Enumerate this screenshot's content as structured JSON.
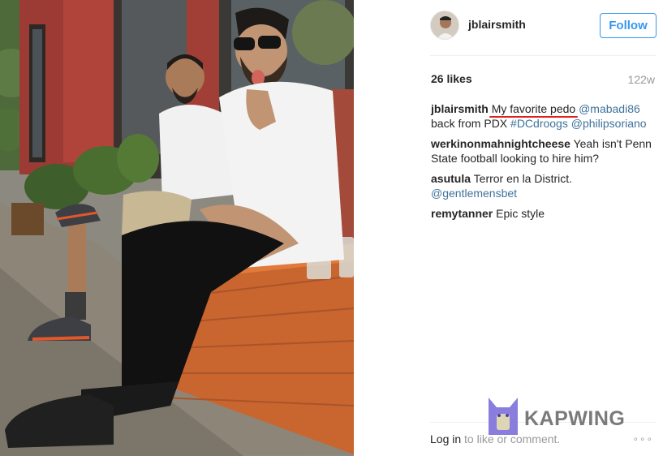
{
  "post": {
    "username": "jblairsmith",
    "follow_label": "Follow",
    "likes": "26 likes",
    "age": "122w",
    "comments": [
      {
        "user": "jblairsmith",
        "parts": [
          "My favorite pedo",
          "@mabadi86",
          "back from PDX",
          "#DCdroogs",
          "@philipsoriano"
        ]
      },
      {
        "user": "werkinonmahnightcheese",
        "parts": [
          "Yeah isn't Penn State football looking to hire him?"
        ]
      },
      {
        "user": "asutula",
        "parts": [
          "Terror en la District.",
          "@gentlemensbet"
        ]
      },
      {
        "user": "remytanner",
        "parts": [
          "Epic style"
        ]
      }
    ],
    "footer": {
      "login_label": "Log in",
      "suffix": "to like or comment."
    },
    "more_label": "∘∘∘"
  },
  "watermark": {
    "text": "KAPWING",
    "icon": "kapwing-cat-logo"
  },
  "colors": {
    "link": "#3f729b",
    "follow": "#3897f0",
    "annotation": "#e0201d",
    "muted": "#999999"
  },
  "icons": {
    "avatar": "user-avatar",
    "more": "more-options-icon"
  }
}
